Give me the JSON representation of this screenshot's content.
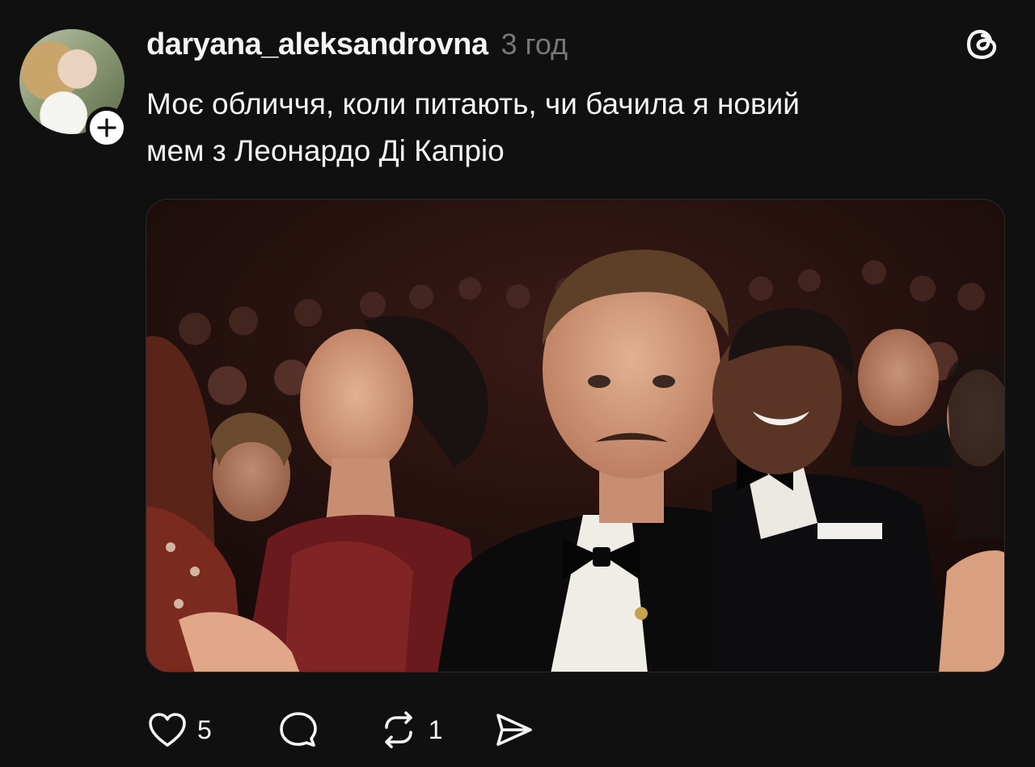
{
  "post": {
    "username": "daryana_aleksandrovna",
    "time": "3 год",
    "caption": "Моє обличчя, коли питають, чи бачила я новий\nмем з Леонардо Ді Капріо"
  },
  "actions": {
    "likes": "5",
    "reposts": "1"
  },
  "icons": {
    "like": "heart-icon",
    "comment": "comment-bubble-icon",
    "repost": "repost-icon",
    "share": "send-icon",
    "brand": "threads-logo-icon",
    "follow": "plus-icon"
  },
  "colors": {
    "background": "#101010",
    "text": "#f3f5f7",
    "muted": "#777777"
  }
}
